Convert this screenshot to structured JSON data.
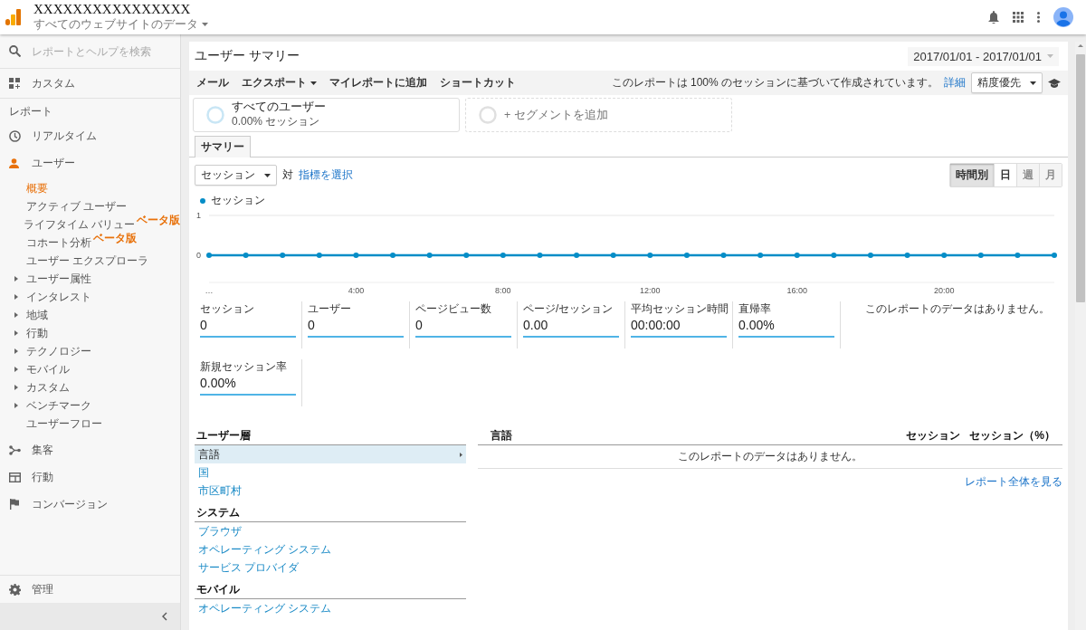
{
  "header": {
    "account": "XXXXXXXXXXXXXXXX",
    "property": "すべてのウェブサイトのデータ"
  },
  "sidebar": {
    "search": {
      "placeholder": "レポートとヘルプを検索"
    },
    "custom": {
      "label": "カスタム"
    },
    "section_label": "レポート",
    "realtime": {
      "label": "リアルタイム",
      "selected": false
    },
    "audience": {
      "label": "ユーザー",
      "selected": true,
      "children": [
        {
          "kind": "page",
          "label": "概要",
          "selected": true
        },
        {
          "kind": "page",
          "label": "アクティブ ユーザー",
          "selected": false
        },
        {
          "kind": "page",
          "label": "ライフタイム バリュー",
          "badge": "ベータ版",
          "selected": false
        },
        {
          "kind": "page",
          "label": "コホート分析",
          "badge": "ベータ版",
          "selected": false
        },
        {
          "kind": "page",
          "label": "ユーザー エクスプローラ",
          "selected": false
        },
        {
          "kind": "group",
          "label": "ユーザー属性",
          "expanded": false,
          "selected": false
        },
        {
          "kind": "group",
          "label": "インタレスト",
          "expanded": false,
          "selected": false
        },
        {
          "kind": "group",
          "label": "地域",
          "expanded": false,
          "selected": false
        },
        {
          "kind": "group",
          "label": "行動",
          "expanded": false,
          "selected": false
        },
        {
          "kind": "group",
          "label": "テクノロジー",
          "expanded": false,
          "selected": false
        },
        {
          "kind": "group",
          "label": "モバイル",
          "expanded": false,
          "selected": false
        },
        {
          "kind": "group",
          "label": "カスタム",
          "expanded": false,
          "selected": false
        },
        {
          "kind": "group",
          "label": "ベンチマーク",
          "expanded": false,
          "selected": false
        },
        {
          "kind": "page",
          "label": "ユーザーフロー",
          "selected": false
        }
      ]
    },
    "acquisition": {
      "label": "集客",
      "selected": false
    },
    "behavior": {
      "label": "行動",
      "selected": false
    },
    "conversions": {
      "label": "コンバージョン",
      "selected": false
    },
    "admin": {
      "label": "管理"
    }
  },
  "report": {
    "title": "ユーザー サマリー",
    "date_range": "2017/01/01 - 2017/01/01",
    "toolbar": {
      "actions": [
        {
          "label": "メール",
          "has_menu": false
        },
        {
          "label": "エクスポート",
          "has_menu": true
        },
        {
          "label": "マイレポートに追加",
          "has_menu": false
        },
        {
          "label": "ショートカット",
          "has_menu": false
        }
      ],
      "sampling_note": "このレポートは 100% のセッションに基づいて作成されています。",
      "details_link": "詳細",
      "precision": "精度優先"
    },
    "segments": [
      {
        "kind": "segment",
        "name": "すべてのユーザー",
        "detail": "0.00% セッション"
      },
      {
        "kind": "add",
        "name": "+ セグメントを追加"
      }
    ],
    "tabs": [
      {
        "label": "サマリー",
        "selected": true
      }
    ],
    "metric_select": "セッション",
    "versus": "対",
    "choose_metric": "指標を選択",
    "granularity": [
      {
        "label": "時間別",
        "selected": true,
        "disabled": false
      },
      {
        "label": "日",
        "selected": false,
        "disabled": false
      },
      {
        "label": "週",
        "selected": false,
        "disabled": true
      },
      {
        "label": "月",
        "selected": false,
        "disabled": true
      }
    ],
    "chart_data": {
      "type": "line",
      "x": [
        0,
        1,
        2,
        3,
        4,
        5,
        6,
        7,
        8,
        9,
        10,
        11,
        12,
        13,
        14,
        15,
        16,
        17,
        18,
        19,
        20,
        21,
        22,
        23
      ],
      "series": [
        {
          "name": "セッション",
          "color": "#058dc7",
          "marker": "circle",
          "values": [
            0,
            0,
            0,
            0,
            0,
            0,
            0,
            0,
            0,
            0,
            0,
            0,
            0,
            0,
            0,
            0,
            0,
            0,
            0,
            0,
            0,
            0,
            0,
            0
          ]
        }
      ],
      "xlim": [
        0,
        23
      ],
      "ylim": [
        0,
        1
      ],
      "yticks": [
        0,
        1
      ],
      "xticks": [
        {
          "value": 0,
          "label": "…"
        },
        {
          "value": 4,
          "label": "4:00"
        },
        {
          "value": 8,
          "label": "8:00"
        },
        {
          "value": 12,
          "label": "12:00"
        },
        {
          "value": 16,
          "label": "16:00"
        },
        {
          "value": 20,
          "label": "20:00"
        }
      ]
    },
    "chart_note": "このレポートのデータはありません。",
    "metrics": [
      {
        "label": "セッション",
        "value": "0"
      },
      {
        "label": "ユーザー",
        "value": "0"
      },
      {
        "label": "ページビュー数",
        "value": "0"
      },
      {
        "label": "ページ/セッション",
        "value": "0.00"
      },
      {
        "label": "平均セッション時間",
        "value": "00:00:00"
      },
      {
        "label": "直帰率",
        "value": "0.00%"
      },
      {
        "label": "新規セッション率",
        "value": "0.00%"
      }
    ],
    "dimension_groups": [
      {
        "heading": "ユーザー層",
        "items": [
          {
            "label": "言語",
            "selected": true
          },
          {
            "label": "国",
            "selected": false
          },
          {
            "label": "市区町村",
            "selected": false
          }
        ]
      },
      {
        "heading": "システム",
        "items": [
          {
            "label": "ブラウザ",
            "selected": false
          },
          {
            "label": "オペレーティング システム",
            "selected": false
          },
          {
            "label": "サービス プロバイダ",
            "selected": false
          }
        ]
      },
      {
        "heading": "モバイル",
        "items": [
          {
            "label": "オペレーティング システム",
            "selected": false
          }
        ]
      }
    ],
    "table": {
      "columns": [
        "言語",
        "セッション",
        "セッション（%）"
      ],
      "empty_message": "このレポートのデータはありません。",
      "full_report_link": "レポート全体を見る"
    }
  }
}
